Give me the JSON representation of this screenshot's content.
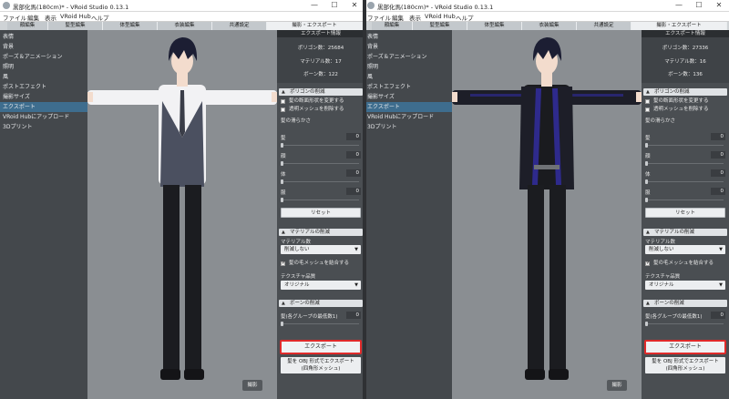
{
  "windows": [
    {
      "title": "黒部化馬(180cm)* - VRoid Studio 0.13.1",
      "window_controls": {
        "minimize": "—",
        "maximize": "☐",
        "close": "✕"
      },
      "menu": [
        "ファイル",
        "編集",
        "表示",
        "VRoid Hub",
        "ヘルプ"
      ],
      "tabs": [
        "顔編集",
        "髪型編集",
        "体型編集",
        "衣装編集",
        "共通設定",
        "撮影・エクスポート"
      ],
      "active_tab_index": 5,
      "sidebar": [
        "表情",
        "背景",
        "ポーズ＆アニメーション",
        "照明",
        "風",
        "ポストエフェクト",
        "撮影サイズ",
        "エクスポート",
        "VRoid Hubにアップロード",
        "3Dプリント"
      ],
      "sidebar_active_index": 7,
      "viewport": {
        "shoot_button": "撮影",
        "outfit": "vest",
        "colors": {
          "shirt": "#f2f2f4",
          "vest": "#4b5060",
          "pants": "#1b1c20",
          "hair": "#1c1e33",
          "skin": "#f3dccd",
          "tie": "#3a3d48"
        }
      },
      "panel": {
        "info_title": "エクスポート情報",
        "polygons": "ポリゴン数：25684",
        "materials": "マテリアル数：17",
        "bones": "ボーン数：122",
        "polygon_section": "ポリゴンの削減",
        "check_hair_cross_section": "髪の断面形状を変更する",
        "check_transparent_mesh": "透明メッシュを削除する",
        "check_hair_cross_section_on": false,
        "check_transparent_mesh_on": false,
        "hair_smoothness": "髪の滑らかさ",
        "slider_rows": [
          {
            "label": "髪",
            "value": "0",
            "level": 0
          },
          {
            "label": "顔",
            "value": "0",
            "level": 0
          },
          {
            "label": "体",
            "value": "0",
            "level": 0
          },
          {
            "label": "服",
            "value": "0",
            "level": 0
          }
        ],
        "reset_button": "リセット",
        "material_section": "マテリアルの削減",
        "material_count_label": "マテリアル数",
        "material_select": "削減しない",
        "check_hair_mesh_merge": "髪の毛メッシュを結合する",
        "check_hair_mesh_merge_on": true,
        "texture_quality_label": "テクスチャ品質",
        "texture_select": "オリジナル",
        "bone_section": "ボーンの削減",
        "bone_label": "髪(各グループの最低数1)",
        "bone_value": "0",
        "bone_level": 0,
        "export_button": "エクスポート",
        "obj_button_line1": "髪を OBJ 形式でエクスポート",
        "obj_button_line2": "(四角形メッシュ)"
      }
    },
    {
      "title": "黒部化馬(180cm)* - VRoid Studio 0.13.1",
      "window_controls": {
        "minimize": "—",
        "maximize": "☐",
        "close": "✕"
      },
      "menu": [
        "ファイル",
        "編集",
        "表示",
        "VRoid Hub",
        "ヘルプ"
      ],
      "tabs": [
        "顔編集",
        "髪型編集",
        "体型編集",
        "衣装編集",
        "共通設定",
        "撮影・エクスポート"
      ],
      "active_tab_index": 5,
      "sidebar": [
        "表情",
        "背景",
        "ポーズ＆アニメーション",
        "照明",
        "風",
        "ポストエフェクト",
        "撮影サイズ",
        "エクスポート",
        "VRoid Hubにアップロード",
        "3Dプリント"
      ],
      "sidebar_active_index": 7,
      "viewport": {
        "shoot_button": "撮影",
        "outfit": "jacket",
        "colors": {
          "shirt": "#1a1b1f",
          "jacket": "#1d1e28",
          "accent": "#2e2a8c",
          "pants": "#1b1c20",
          "hair": "#1c1e33",
          "skin": "#f3dccd",
          "belt": "#6f7276"
        }
      },
      "panel": {
        "info_title": "エクスポート情報",
        "polygons": "ポリゴン数：27336",
        "materials": "マテリアル数：16",
        "bones": "ボーン数：136",
        "polygon_section": "ポリゴンの削減",
        "check_hair_cross_section": "髪の断面形状を変更する",
        "check_transparent_mesh": "透明メッシュを削除する",
        "check_hair_cross_section_on": false,
        "check_transparent_mesh_on": false,
        "hair_smoothness": "髪の滑らかさ",
        "slider_rows": [
          {
            "label": "髪",
            "value": "0",
            "level": 0
          },
          {
            "label": "顔",
            "value": "0",
            "level": 0
          },
          {
            "label": "体",
            "value": "0",
            "level": 0
          },
          {
            "label": "服",
            "value": "0",
            "level": 0
          }
        ],
        "reset_button": "リセット",
        "material_section": "マテリアルの削減",
        "material_count_label": "マテリアル数",
        "material_select": "削減しない",
        "check_hair_mesh_merge": "髪の毛メッシュを結合する",
        "check_hair_mesh_merge_on": true,
        "texture_quality_label": "テクスチャ品質",
        "texture_select": "オリジナル",
        "bone_section": "ボーンの削減",
        "bone_label": "髪(各グループの最低数1)",
        "bone_value": "0",
        "bone_level": 0,
        "export_button": "エクスポート",
        "obj_button_line1": "髪を OBJ 形式でエクスポート",
        "obj_button_line2": "(四角形メッシュ)"
      }
    }
  ]
}
